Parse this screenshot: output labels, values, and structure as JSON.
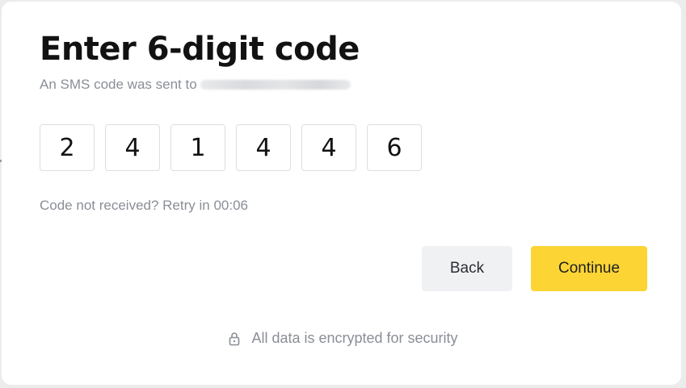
{
  "header": {
    "title": "Enter 6-digit code",
    "subtitle": "An SMS code was sent to"
  },
  "code": {
    "digits": [
      "2",
      "4",
      "1",
      "4",
      "4",
      "6"
    ]
  },
  "retry": {
    "text": "Code not received? Retry in 00:06"
  },
  "actions": {
    "back_label": "Back",
    "continue_label": "Continue"
  },
  "footer": {
    "security_text": "All data is encrypted for security",
    "icon": "lock-icon"
  },
  "colors": {
    "accent": "#fcd535",
    "secondary_button": "#f0f1f3",
    "muted_text": "#8a8e96",
    "title_text": "#121212"
  }
}
